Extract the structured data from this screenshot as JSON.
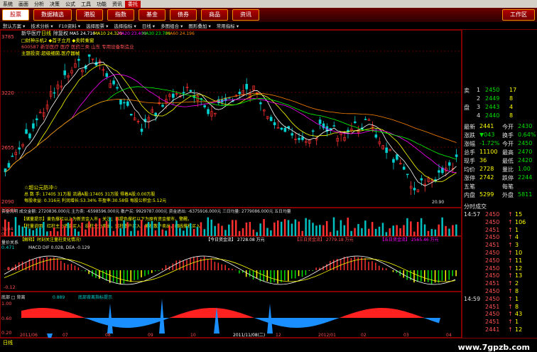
{
  "menubar": [
    "系统",
    "画面",
    "分析",
    "决策",
    "公式",
    "工具",
    "功能",
    "资讯",
    "委托"
  ],
  "navbar": {
    "items": [
      "股票",
      "数据精选",
      "港股",
      "指数",
      "基金",
      "债券",
      "商品",
      "资讯"
    ],
    "selected": 0,
    "workspace": "工作区"
  },
  "toolbar": [
    "默认方案",
    "技术分析",
    "F10资料",
    "选择股票",
    "选择指标",
    "日线",
    "多图组合",
    "图形叠加",
    "常用指标"
  ],
  "main_header": {
    "stock": "新华医疗",
    "period": "日线",
    "qfq": "除复权",
    "ma_labels": [
      "MA5 24.716",
      "MA10 24.320",
      "MA20 23.400",
      "MA30 23.786",
      "MA60 24.196"
    ]
  },
  "annotations": {
    "info1": "□财神示机2 ◆首子立月 ◆卖转乘窗",
    "info2": "600587 新华医疗 医疗 医药三类 山东 专用设备制造业",
    "info3": "主题投资:超级细菌,医疗器械",
    "fund_title": "☆超公元防冲☆",
    "fund_line1": "总 数 手: 17405 31万股  流通A股:17405 31万股  得着A股:0.00万股",
    "fund_line2": "每股收益: 0.316元  利润增长:53.34%  市盈率:30.58倍  每股公积金:5.12元",
    "flow_line": "资金流明 成交金额: 2720836.000元  主力卖: -6598596.000元 散户买: 9929787.000元  资金进出: -6375916.000元  三日均量: 2779086.000元  五日均量",
    "signal1": "【储量提示】黄色撑杠以上为新资金入市，关注；指提色撑杠以下为原有资金撤市，警醒。",
    "signal2": "【柱量说明】红柱主力资金买入，绿柱主力卖出，蓝柱散户买入，紫柱散户卖出，细线撑杠买入。",
    "flow_today": "【今日资金流】 2728.08 万元",
    "flow_3d": "【三日资金流】 2779.18 万元",
    "flow_5d": "【五日资金流】 2565.46 万元",
    "macd_label": "MACD DIF 0.028, DEA -0.129",
    "bottom_label": "底部 □ 背离",
    "bottom_val": "0.889",
    "bottom_label2": "底部背离指标提示",
    "low_price": "20.90",
    "hint_bar": "【解释】时刻关注量柱变化情况!",
    "vol_label": "量价关系"
  },
  "y_axis": {
    "main": [
      "3785",
      "3220",
      "2655",
      "2090"
    ],
    "vol": [
      "13661",
      "3104",
      "0"
    ],
    "macd": [
      "0.471",
      "0.12",
      "-0.12"
    ],
    "bottom": [
      "1.00",
      "0.60",
      "0.20"
    ]
  },
  "x_axis": [
    "2011/06",
    "07",
    "08",
    "09",
    "10",
    "2011/11/08(二)",
    "12",
    "2012/01",
    "02",
    "03",
    "04"
  ],
  "right_panel": {
    "orders": [
      {
        "label": "卖",
        "price": "2450",
        "vol": "17"
      },
      {
        "label": "",
        "price": "2449",
        "vol": "8"
      },
      {
        "label": "盘",
        "price": "2443",
        "vol": "4"
      },
      {
        "label": "",
        "price": "2440",
        "vol": "8"
      }
    ],
    "stats": [
      {
        "k": "最新",
        "v": "2441",
        "k2": "今开",
        "v2": "2430"
      },
      {
        "k": "涨跌",
        "v": "▼043",
        "k2": "换手",
        "v2": "0.64%"
      },
      {
        "k": "涨幅",
        "v": "-1.72%",
        "k2": "今开",
        "v2": "2450"
      },
      {
        "k": "总手",
        "v": "11100",
        "k2": "最高",
        "v2": "2470"
      },
      {
        "k": "现手",
        "v": "36",
        "k2": "最低",
        "v2": "2420"
      },
      {
        "k": "均价",
        "v": "2728",
        "k2": "量比",
        "v2": "1.00"
      },
      {
        "k": "涨停",
        "v": "2742",
        "k2": "跌停",
        "v2": "2244"
      },
      {
        "k": "五笔",
        "v": "",
        "k2": "每笔",
        "v2": ""
      },
      {
        "k": "内盘",
        "v": "5299",
        "k2": "外盘",
        "v2": "5811"
      }
    ],
    "trades_header": "分时成交",
    "trades": [
      {
        "t": "14:57",
        "p": "2450",
        "v": "15"
      },
      {
        "t": "",
        "p": "2450",
        "v": "106"
      },
      {
        "t": "",
        "p": "2451",
        "v": "1"
      },
      {
        "t": "",
        "p": "2450",
        "v": "4"
      },
      {
        "t": "",
        "p": "2451",
        "v": "3"
      },
      {
        "t": "",
        "p": "2450",
        "v": "10"
      },
      {
        "t": "",
        "p": "2450",
        "v": "11"
      },
      {
        "t": "",
        "p": "2450",
        "v": "12"
      },
      {
        "t": "",
        "p": "2450",
        "v": "13"
      },
      {
        "t": "",
        "p": "2451",
        "v": "2"
      },
      {
        "t": "",
        "p": "2450",
        "v": "8"
      },
      {
        "t": "14:59",
        "p": "2450",
        "v": "1"
      },
      {
        "t": "",
        "p": "2451",
        "v": "8"
      },
      {
        "t": "",
        "p": "2450",
        "v": "43"
      },
      {
        "t": "",
        "p": "2451",
        "v": "1"
      },
      {
        "t": "",
        "p": "2441",
        "v": "12"
      }
    ]
  },
  "statusbar": {
    "left": "日线",
    "watermark": "www.7gpzb.com"
  },
  "colors": {
    "up": "#ff3030",
    "down": "#00d0d0",
    "ma5": "#ffffff",
    "ma10": "#ffff00",
    "ma20": "#ff00ff",
    "ma30": "#00ff00",
    "ma60": "#ff8000"
  }
}
